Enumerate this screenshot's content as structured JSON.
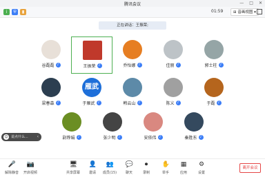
{
  "window": {
    "title": "腾讯会议",
    "minimize": "—",
    "maximize": "□",
    "close": "✕"
  },
  "toolbar": {
    "timer": "01:59",
    "view_label": "⊞ 音画视图 ▾"
  },
  "speaking": "正在讲话：王振荣;",
  "participants": [
    {
      "name": "谷磊磊",
      "avatar": "",
      "color": "#e8e0d8",
      "mic": "on"
    },
    {
      "name": "王振荣",
      "avatar": "",
      "color": "#c0392b",
      "mic": "on"
    },
    {
      "name": "乔怡娜",
      "avatar": "",
      "color": "#e67e22",
      "mic": "on"
    },
    {
      "name": "佳丽",
      "avatar": "",
      "color": "#bdc3c7",
      "mic": "on"
    },
    {
      "name": "郭士柱",
      "avatar": "",
      "color": "#95a5a6",
      "mic": "on"
    },
    {
      "name": "梁春森",
      "avatar": "",
      "color": "#2c3e50",
      "mic": "on"
    },
    {
      "name": "于雁武",
      "avatar": "雁武",
      "color": "#1e6fd9",
      "mic": "on"
    },
    {
      "name": "韩云山",
      "avatar": "",
      "color": "#5d8aa8",
      "mic": "on"
    },
    {
      "name": "陈义",
      "avatar": "",
      "color": "#a0a0a0",
      "mic": "on"
    },
    {
      "name": "于磊",
      "avatar": "",
      "color": "#b5651d",
      "mic": "on"
    },
    {
      "name": "尉荐娟",
      "avatar": "",
      "color": "#6b8e23",
      "mic": "on"
    },
    {
      "name": "张少明",
      "avatar": "",
      "color": "#444444",
      "mic": "on"
    },
    {
      "name": "安依伟",
      "avatar": "",
      "color": "#d98880",
      "mic": "on"
    },
    {
      "name": "秦胜东",
      "avatar": "",
      "color": "#34495e",
      "mic": "on"
    }
  ],
  "chat": {
    "placeholder": "说点什么...",
    "arrow": "‹"
  },
  "bottombar": {
    "items": [
      {
        "label": "解除静音",
        "icon": "🎤"
      },
      {
        "label": "开启视频",
        "icon": "📷"
      },
      {
        "label": "共享屏幕",
        "icon": "🖥"
      },
      {
        "label": "邀请",
        "icon": "👤"
      },
      {
        "label": "成员(15)",
        "icon": "👥"
      },
      {
        "label": "聊天",
        "icon": "💬"
      },
      {
        "label": "录制",
        "icon": "⏺"
      },
      {
        "label": "举手",
        "icon": "✋"
      },
      {
        "label": "应用",
        "icon": "▦"
      },
      {
        "label": "设置",
        "icon": "⚙"
      }
    ],
    "leave": "离开会议"
  },
  "colors": {
    "accent": "#3c7ef7",
    "active_border": "#4caf50",
    "leave": "#e54545"
  }
}
